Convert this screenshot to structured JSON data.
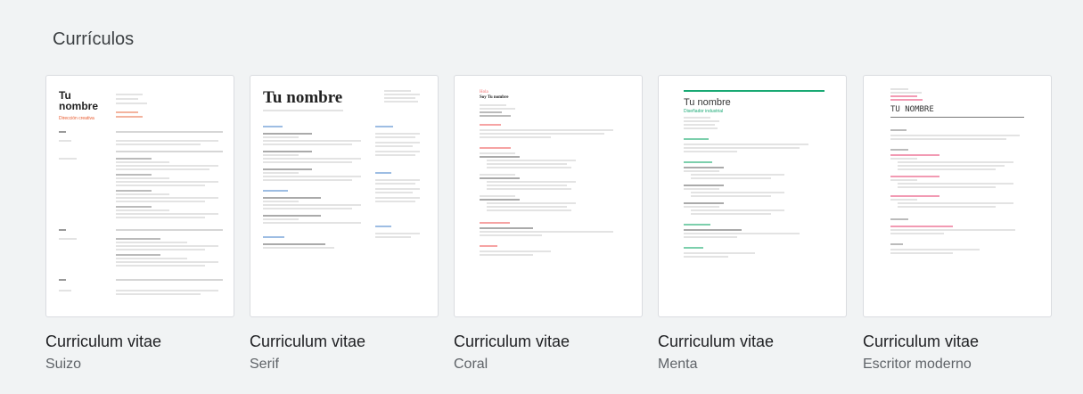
{
  "section": {
    "title": "Currículos"
  },
  "templates": [
    {
      "title": "Curriculum vitae",
      "subtitle": "Suizo"
    },
    {
      "title": "Curriculum vitae",
      "subtitle": "Serif"
    },
    {
      "title": "Curriculum vitae",
      "subtitle": "Coral"
    },
    {
      "title": "Curriculum vitae",
      "subtitle": "Menta"
    },
    {
      "title": "Curriculum vitae",
      "subtitle": "Escritor moderno"
    }
  ],
  "previews": {
    "suizo": {
      "name": "Tu nombre",
      "subtitle": "Dirección creativa"
    },
    "serif": {
      "name": "Tu nombre"
    },
    "coral": {
      "name": "Hola",
      "subname": "Soy Tu nombre"
    },
    "menta": {
      "name": "Tu nombre",
      "subtitle": "Diseñador industrial"
    },
    "escritor": {
      "name": "TU NOMBRE"
    }
  },
  "colors": {
    "suizo_accent": "#e8572a",
    "serif_accent": "#4a86c8",
    "coral_accent": "#f26d6d",
    "menta_accent": "#19a974",
    "escritor_accent": "#e6456f"
  }
}
